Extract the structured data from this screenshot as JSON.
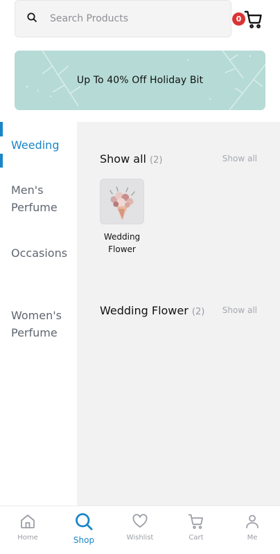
{
  "search": {
    "placeholder": "Search Products",
    "icon": "search-icon"
  },
  "cart": {
    "count": "0",
    "icon": "cart-icon",
    "badge_color": "#d83434"
  },
  "banner": {
    "text": "Up To 40%  Off Holiday Bit",
    "background": "#b6dbd6"
  },
  "categories": [
    {
      "label": "Weeding",
      "active": true
    },
    {
      "label": "Men's Perfume",
      "active": false
    },
    {
      "label": "Occasions",
      "active": false
    },
    {
      "label": "Women's Perfume",
      "active": false
    }
  ],
  "sections": [
    {
      "title": "Show all",
      "count": "(2)",
      "show_all": "Show all",
      "products": [
        {
          "name": "Wedding Flower"
        }
      ]
    },
    {
      "title": "Wedding Flower",
      "count": "(2)",
      "show_all": "Show all",
      "products": []
    }
  ],
  "bottom_nav": [
    {
      "label": "Home",
      "icon": "home-icon",
      "active": false
    },
    {
      "label": "Shop",
      "icon": "search-icon",
      "active": true
    },
    {
      "label": "Wishlist",
      "icon": "heart-icon",
      "active": false
    },
    {
      "label": "Cart",
      "icon": "cart-icon",
      "active": false
    },
    {
      "label": "Me",
      "icon": "user-icon",
      "active": false
    }
  ],
  "colors": {
    "accent": "#1a86c8",
    "panel_background": "#f2f2f3"
  }
}
